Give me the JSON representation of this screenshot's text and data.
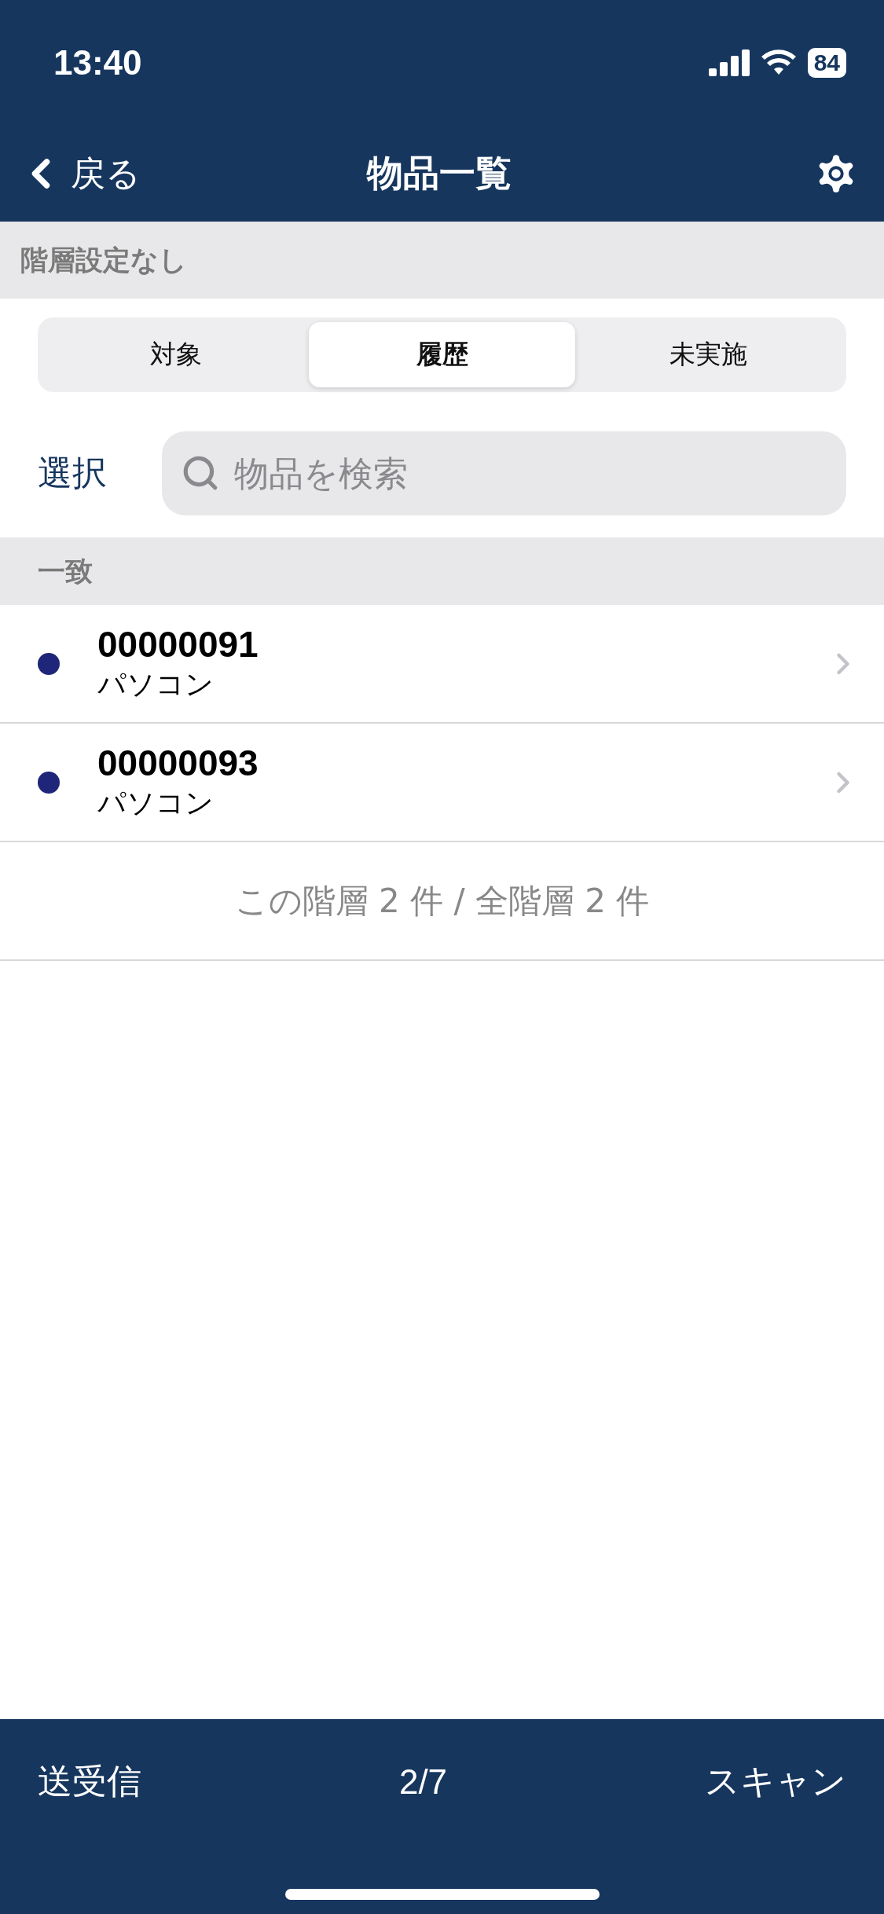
{
  "status_bar": {
    "time": "13:40",
    "battery": "84"
  },
  "nav": {
    "back": "戻る",
    "title": "物品一覧"
  },
  "hierarchy": "階層設定なし",
  "tabs": [
    {
      "label": "対象",
      "selected": false
    },
    {
      "label": "履歴",
      "selected": true
    },
    {
      "label": "未実施",
      "selected": false
    }
  ],
  "select_button": "選択",
  "search": {
    "placeholder": "物品を検索"
  },
  "section": "一致",
  "items": [
    {
      "code": "00000091",
      "name": "パソコン",
      "color": "#1f2578"
    },
    {
      "code": "00000093",
      "name": "パソコン",
      "color": "#1f2578"
    }
  ],
  "summary": "この階層 2 件 / 全階層 2 件",
  "bottom_bar": {
    "left": "送受信",
    "page": "2/7",
    "right": "スキャン"
  }
}
